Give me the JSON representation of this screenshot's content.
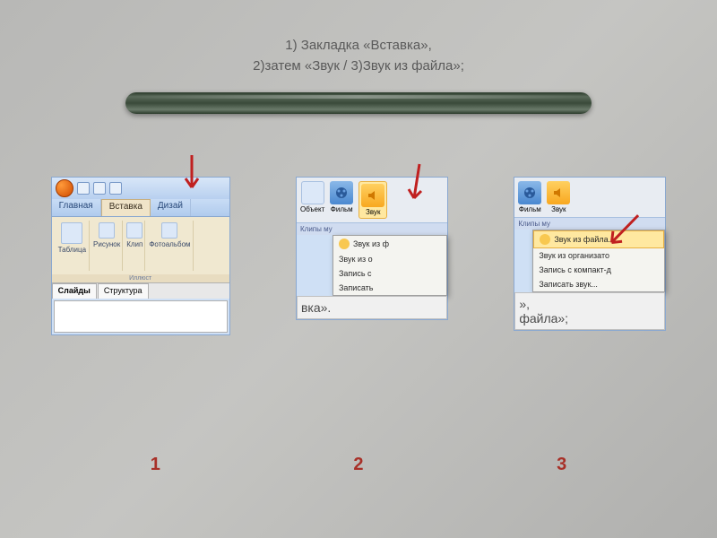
{
  "title": {
    "line1": "1) Закладка «Вставка»,",
    "line2": "2)затем  «Звук / 3)Звук из файла»;"
  },
  "shot1": {
    "tabs": {
      "home": "Главная",
      "insert": "Вставка",
      "design": "Дизай"
    },
    "groups": {
      "table": "Таблица",
      "picture": "Рисунок",
      "clip": "Клип",
      "photoalbum": "Фотоальбом"
    },
    "group_caption": "Иллюст",
    "panel_tabs": {
      "slides": "Слайды",
      "structure": "Структура"
    }
  },
  "shot2": {
    "object": "Объект",
    "film": "Фильм",
    "sound": "Звук",
    "caption": "Клипы му",
    "menu": {
      "from_file": "Звук из ф",
      "from_org": "Звук из о",
      "record": "Запись с",
      "write": "Записать"
    },
    "text_below": "вка»."
  },
  "shot3": {
    "film": "Фильм",
    "sound": "Звук",
    "caption": "Клипы му",
    "menu": {
      "from_file": "Звук из файла...",
      "from_org": "Звук из организато",
      "record": "Запись с компакт-д",
      "write": "Записать звук..."
    },
    "text_below1": "»,",
    "text_below2": "файла»;"
  },
  "numbers": {
    "n1": "1",
    "n2": "2",
    "n3": "3"
  }
}
